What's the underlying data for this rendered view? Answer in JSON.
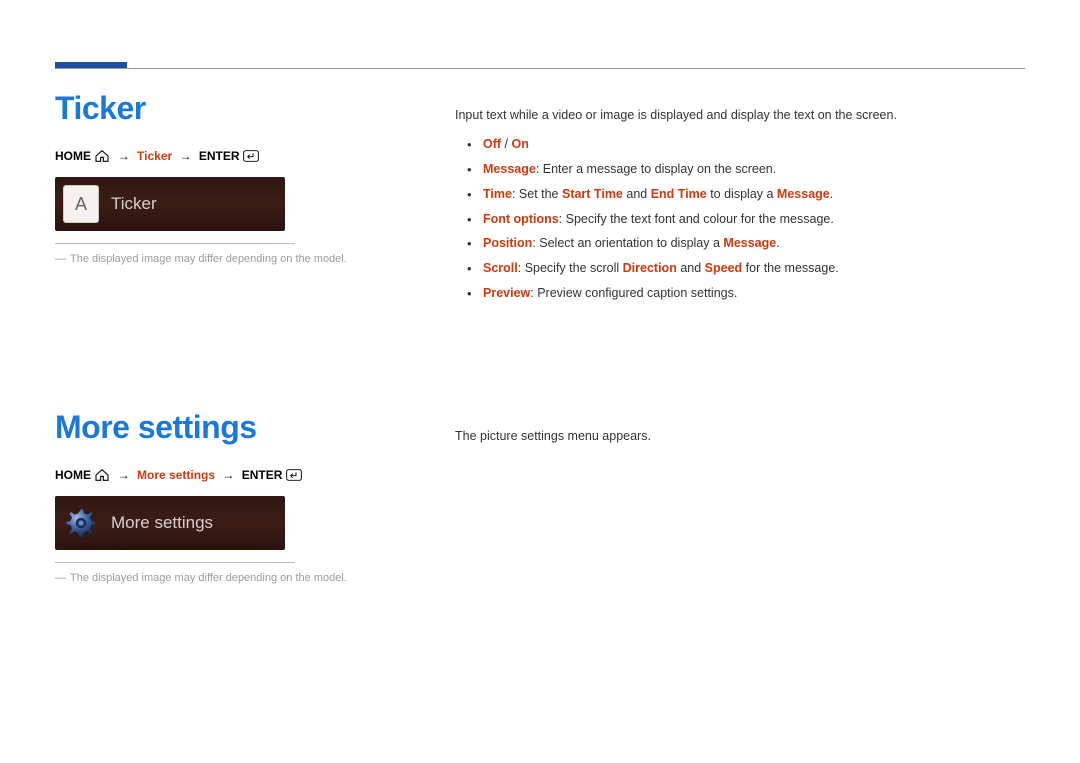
{
  "section1": {
    "heading": "Ticker",
    "breadcrumb": {
      "home": "HOME",
      "middle": "Ticker",
      "enter": "ENTER"
    },
    "tile_label": "Ticker",
    "tile_icon_letter": "A",
    "note": "The displayed image may differ depending on the model.",
    "intro": "Input text while a video or image is displayed and display the text on the screen.",
    "bullets": {
      "b1_off": "Off",
      "b1_sep": " / ",
      "b1_on": "On",
      "b2_key": "Message",
      "b2_txt": ": Enter a message to display on the screen.",
      "b3_key": "Time",
      "b3_txt1": ": Set the ",
      "b3_h1": "Start Time",
      "b3_txt2": " and ",
      "b3_h2": "End Time",
      "b3_txt3": " to display a ",
      "b3_h3": "Message",
      "b3_txt4": ".",
      "b4_key": "Font options",
      "b4_txt": ": Specify the text font and colour for the message.",
      "b5_key": "Position",
      "b5_txt1": ": Select an orientation to display a ",
      "b5_h1": "Message",
      "b5_txt2": ".",
      "b6_key": "Scroll",
      "b6_txt1": ": Specify the scroll ",
      "b6_h1": "Direction",
      "b6_txt2": " and ",
      "b6_h2": "Speed",
      "b6_txt3": " for the message.",
      "b7_key": "Preview",
      "b7_txt": ": Preview configured caption settings."
    }
  },
  "section2": {
    "heading": "More settings",
    "breadcrumb": {
      "home": "HOME",
      "middle": "More settings",
      "enter": "ENTER"
    },
    "tile_label": "More settings",
    "note": "The displayed image may differ depending on the model.",
    "body": "The picture settings menu appears."
  }
}
